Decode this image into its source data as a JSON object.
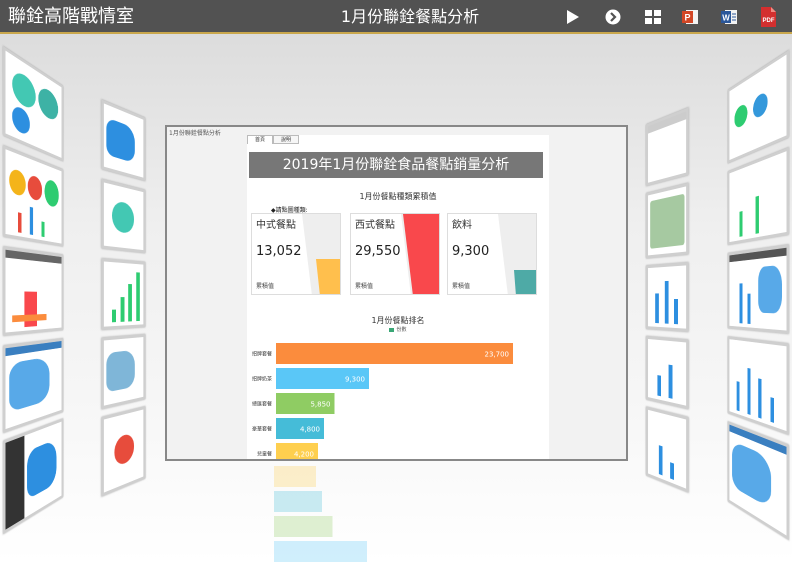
{
  "header": {
    "app_title": "聯銓高階戰情室",
    "page_title": "1月份聯銓餐點分析"
  },
  "toolbar": {
    "play_icon": "play-icon",
    "next_icon": "next-circle-icon",
    "grid_icon": "grid-icon",
    "ppt_icon": "powerpoint-icon",
    "word_icon": "word-icon",
    "pdf_icon": "pdf-icon",
    "pdf_label": "PDF"
  },
  "slide": {
    "tab_label": "1月份聯銓餐點分析",
    "report_tabs": [
      "首頁",
      "說明"
    ],
    "banner": "2019年1月份聯銓食品餐點銷量分析",
    "section1_title": "1月份餐點種類累積值",
    "note": "◆請點圖種類:",
    "cards": [
      {
        "name": "中式餐點",
        "value": "13,052",
        "label": "累積值",
        "color": "#ffbf4d",
        "fill": 0.44
      },
      {
        "name": "西式餐點",
        "value": "29,550",
        "label": "累積值",
        "color": "#f9484c",
        "fill": 1.0
      },
      {
        "name": "飲料",
        "value": "9,300",
        "label": "累積值",
        "color": "#4eaaa6",
        "fill": 0.31
      }
    ],
    "section2_title": "1月份餐點排名",
    "legend": "份數"
  },
  "chart_data": {
    "type": "bar",
    "orientation": "horizontal",
    "title": "1月份餐點排名",
    "legend": [
      "份數"
    ],
    "categories": [
      "招牌套餐",
      "招牌奶茶",
      "總匯套餐",
      "豪華套餐",
      "兒童餐"
    ],
    "values": [
      23700,
      9300,
      5850,
      4800,
      4200
    ],
    "value_labels": [
      "23,700",
      "9,300",
      "5,850",
      "4,800",
      "4,200"
    ],
    "colors": [
      "#fb8c3d",
      "#5ac7f7",
      "#8fcc63",
      "#45bcd8",
      "#fecf4f"
    ],
    "xlim": [
      0,
      26500
    ]
  }
}
